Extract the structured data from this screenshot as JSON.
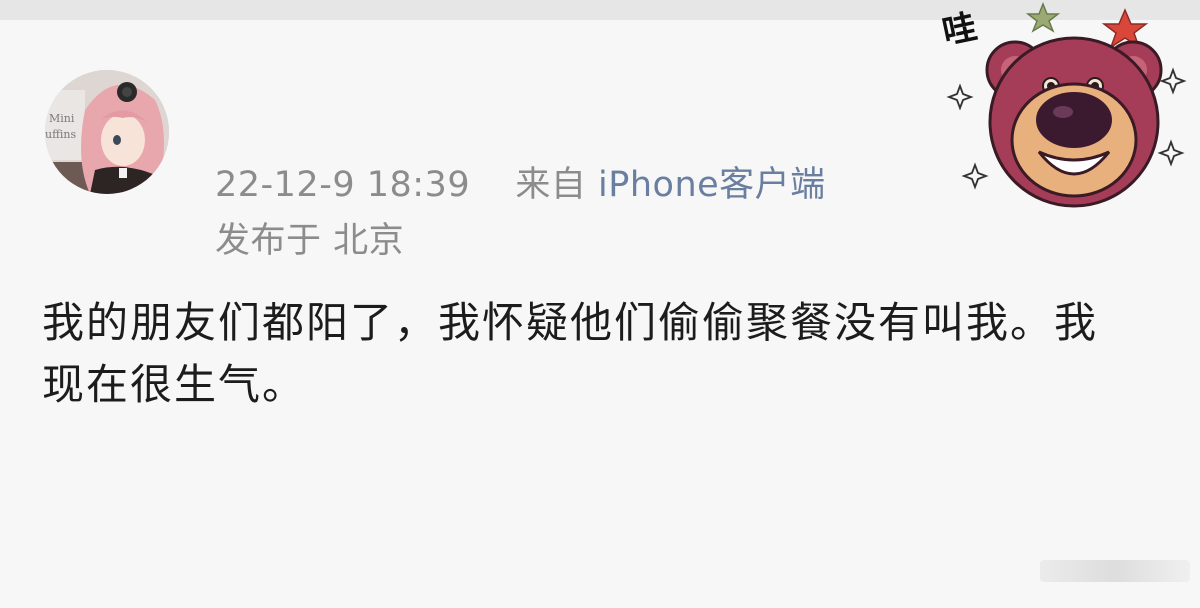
{
  "post": {
    "timestamp": "22-12-9 18:39",
    "source_prefix": "来自",
    "device": "iPhone客户端",
    "location": "发布于 北京",
    "body": "我的朋友们都阳了，我怀疑他们偷偷聚餐没有叫我。我现在很生气。"
  },
  "avatar": {
    "sign_text_1": "Mini",
    "sign_text_2": "uffins"
  },
  "sticker": {
    "exclamation": "哇",
    "icon": "strawberry-bear-icon",
    "colors": {
      "fur": "#a63d58",
      "muzzle": "#e8b07c",
      "nose": "#3b1a2f",
      "star_red": "#d9473b",
      "star_green": "#8ea26a"
    }
  }
}
